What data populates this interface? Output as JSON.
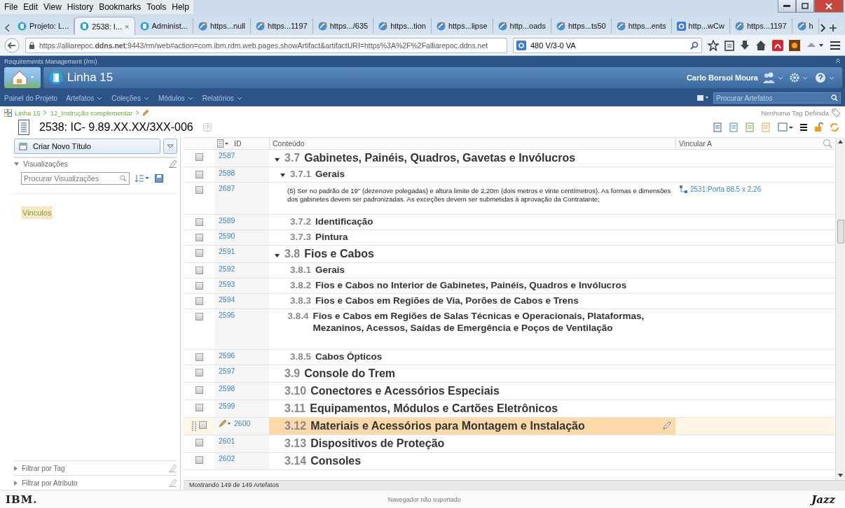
{
  "browser": {
    "menu": [
      "File",
      "Edit",
      "View",
      "History",
      "Bookmarks",
      "Tools",
      "Help"
    ],
    "tabs": [
      {
        "label": "Projeto: L...",
        "kind": "app",
        "selected": false
      },
      {
        "label": "2538: I...",
        "kind": "app",
        "selected": true,
        "close": "×"
      },
      {
        "label": "Administ...",
        "kind": "app",
        "selected": false
      },
      {
        "label": "https...null",
        "kind": "web",
        "selected": false
      },
      {
        "label": "https...1197",
        "kind": "web",
        "selected": false
      },
      {
        "label": "https.../635",
        "kind": "web",
        "selected": false
      },
      {
        "label": "https...tion",
        "kind": "web",
        "selected": false
      },
      {
        "label": "https...lipse",
        "kind": "web",
        "selected": false
      },
      {
        "label": "http...oads",
        "kind": "web",
        "selected": false
      },
      {
        "label": "https...ts50",
        "kind": "web",
        "selected": false
      },
      {
        "label": "https...ents",
        "kind": "web",
        "selected": false
      },
      {
        "label": "http...wCw",
        "kind": "search",
        "selected": false
      },
      {
        "label": "https...1197",
        "kind": "web",
        "selected": false
      },
      {
        "label": "h",
        "kind": "web",
        "selected": false
      }
    ],
    "url": "https://alliarepoc.**ddns.net**:9443/rm/web#action=com.ibm.rdm.web.pages.showArtifact&artifactURI=https%3A%2F%2Falliarepoc.ddns.net",
    "search": "480 V/3-0 VA"
  },
  "app": {
    "product": "Requirements Management (/rm)",
    "project": "Linha 15",
    "user": "Carlo Borsoi Moura",
    "nav": [
      {
        "label": "Painel do Projeto",
        "menu": false
      },
      {
        "label": "Artefatos",
        "menu": true
      },
      {
        "label": "Coleções",
        "menu": true
      },
      {
        "label": "Módulos",
        "menu": true
      },
      {
        "label": "Relatórios",
        "menu": true
      }
    ],
    "search_placeholder": "Procurar Artefatos"
  },
  "artifact": {
    "breadcrumb": [
      "Linha 15",
      "12_Instrução complementar"
    ],
    "tags": "Nenhuma Tag Definida",
    "title": "2538: IC- 9.89.XX.XX/3XX-006"
  },
  "sidebar": {
    "create_button": "Criar Novo Título",
    "views_title": "Visualizações",
    "views_search": "Procurar Visualizações",
    "links": "Vinculos",
    "filters": [
      "Filtrar por Tag",
      "Filtrar por Atributo"
    ]
  },
  "table": {
    "columns": [
      "ID",
      "Conteúdo",
      "Vincular A"
    ],
    "rows": [
      {
        "id": "2587",
        "kind": "h2",
        "number": "3.7",
        "title": "Gabinetes, Painéis, Quadros, Gavetas e Invólucros",
        "expanded": true,
        "selected": false
      },
      {
        "id": "2588",
        "kind": "h3",
        "number": "3.7.1",
        "title": "Gerais",
        "expanded": true,
        "selected": false
      },
      {
        "id": "2687",
        "kind": "text",
        "text": "(5) Ser no padrão de 19\" (dezenove polegadas) e altura limite de 2,20m (dois metros e vinte centímetros). As formas e dimensões dos gabinetes devem ser padronizadas. As exceções devem ser submetidas à aprovação da Contratante;",
        "link": "2531:Porta 88.5 x 2.26",
        "selected": false
      },
      {
        "id": "2589",
        "kind": "h3",
        "number": "3.7.2",
        "title": "Identificação",
        "selected": false
      },
      {
        "id": "2590",
        "kind": "h3",
        "number": "3.7.3",
        "title": "Pintura",
        "selected": false
      },
      {
        "id": "2591",
        "kind": "h2",
        "number": "3.8",
        "title": "Fios e Cabos",
        "expanded": true,
        "selected": false
      },
      {
        "id": "2592",
        "kind": "h3",
        "number": "3.8.1",
        "title": "Gerais",
        "selected": false
      },
      {
        "id": "2593",
        "kind": "h3",
        "number": "3.8.2",
        "title": "Fios e Cabos no Interior de Gabinetes, Painéis, Quadros e Invólucros",
        "selected": false
      },
      {
        "id": "2594",
        "kind": "h3",
        "number": "3.8.3",
        "title": "Fios e Cabos em Regiões de Via, Porões de Cabos e Trens",
        "selected": false
      },
      {
        "id": "2595",
        "kind": "h3",
        "number": "3.8.4",
        "title": "Fios e Cabos em Regiões de Salas Técnicas e Operacionais, Plataformas, Mezaninos, Acessos, Saídas de Emergência e Poços de Ventilação",
        "selected": false
      },
      {
        "id": "2596",
        "kind": "h3",
        "number": "3.8.5",
        "title": "Cabos Ópticos",
        "selected": false
      },
      {
        "id": "2597",
        "kind": "h2",
        "number": "3.9",
        "title": "Console do Trem",
        "selected": false
      },
      {
        "id": "2598",
        "kind": "h2",
        "number": "3.10",
        "title": "Conectores e Acessórios Especiais",
        "selected": false
      },
      {
        "id": "2599",
        "kind": "h2",
        "number": "3.11",
        "title": "Equipamentos, Módulos e Cartões Eletrônicos",
        "selected": false
      },
      {
        "id": "2600",
        "kind": "h2",
        "number": "3.12",
        "title": "Materiais e Acessórios para Montagem e Instalação",
        "selected": true
      },
      {
        "id": "2601",
        "kind": "h2",
        "number": "3.13",
        "title": "Dispositivos de Proteção",
        "selected": false
      },
      {
        "id": "2602",
        "kind": "h2",
        "number": "3.14",
        "title": "Consoles",
        "selected": false
      }
    ],
    "status": "Mostrando 149 de 149 Artefatos"
  },
  "footer": {
    "brand": "IBM.",
    "message": "Navegador não suportado",
    "logo": "Jazz"
  }
}
